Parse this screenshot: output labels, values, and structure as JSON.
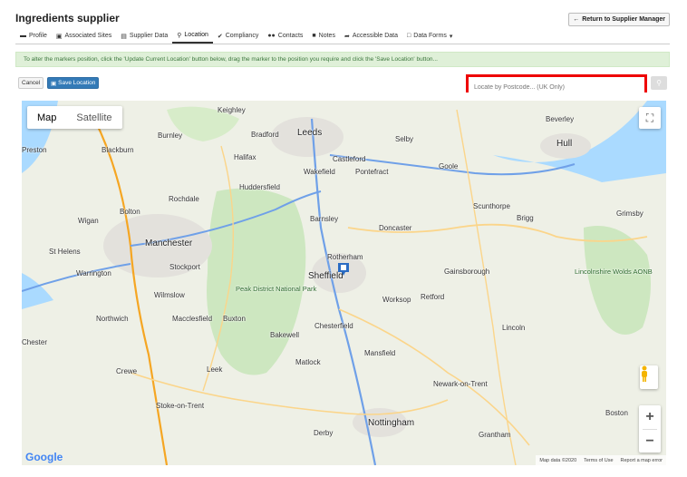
{
  "header": {
    "title": "Ingredients supplier",
    "return_label": "Return to Supplier Manager"
  },
  "tabs": [
    {
      "label": "Profile",
      "icon": "id-card-icon"
    },
    {
      "label": "Associated Sites",
      "icon": "building-icon"
    },
    {
      "label": "Supplier Data",
      "icon": "table-icon"
    },
    {
      "label": "Location",
      "icon": "map-pin-icon"
    },
    {
      "label": "Compliancy",
      "icon": "check-icon"
    },
    {
      "label": "Contacts",
      "icon": "users-icon"
    },
    {
      "label": "Notes",
      "icon": "note-icon"
    },
    {
      "label": "Accessible Data",
      "icon": "share-icon"
    },
    {
      "label": "Data Forms",
      "icon": "form-icon"
    }
  ],
  "notice": "To alter the markers position, click the 'Update Current Location' button below, drag the marker to the position you require and click the 'Save Location' button...",
  "actions": {
    "cancel": "Cancel",
    "save": "Save Location"
  },
  "postcode": {
    "placeholder": "Locate by Postcode... (UK Only)"
  },
  "map": {
    "type_map": "Map",
    "type_satellite": "Satellite",
    "google": "Google",
    "attribution": {
      "data": "Map data ©2020",
      "terms": "Terms of Use",
      "report": "Report a map error"
    },
    "places": {
      "leeds": "Leeds",
      "bradford": "Bradford",
      "sheffield": "Sheffield",
      "manchester": "Manchester",
      "huddersfield": "Huddersfield",
      "halifax": "Halifax",
      "wakefield": "Wakefield",
      "barnsley": "Barnsley",
      "doncaster": "Doncaster",
      "rotherham": "Rotherham",
      "stockport": "Stockport",
      "chesterfield": "Chesterfield",
      "nottingham": "Nottingham",
      "derby": "Derby",
      "lincoln": "Lincoln",
      "hull": "Hull",
      "grimsby": "Grimsby",
      "scunthorpe": "Scunthorpe",
      "stoke": "Stoke-on-Trent",
      "macclesfield": "Macclesfield",
      "preston": "Preston",
      "blackburn": "Blackburn",
      "bolton": "Bolton",
      "wigan": "Wigan",
      "warrington": "Warrington",
      "st_helens": "St Helens",
      "rochdale": "Rochdale",
      "burnley": "Burnley",
      "keighley": "Keighley",
      "selby": "Selby",
      "goole": "Goole",
      "pontefract": "Pontefract",
      "castleford": "Castleford",
      "worksop": "Worksop",
      "retford": "Retford",
      "gainsborough": "Gainsborough",
      "newark": "Newark-on-Trent",
      "grantham": "Grantham",
      "boston": "Boston",
      "matlock": "Matlock",
      "buxton": "Buxton",
      "bakewell": "Bakewell",
      "leek": "Leek",
      "crewe": "Crewe",
      "northwich": "Northwich",
      "chester": "Chester",
      "wilmslow": "Wilmslow",
      "mansfield": "Mansfield",
      "brigg": "Brigg",
      "beverley": "Beverley",
      "peak_district": "Peak District National Park",
      "lincs_wolds": "Lincolnshire Wolds AONB"
    }
  },
  "colors": {
    "accent": "#337ab7",
    "highlight": "#e00000",
    "notice_bg": "#dff0d8",
    "marker": "#2b6cc4"
  }
}
